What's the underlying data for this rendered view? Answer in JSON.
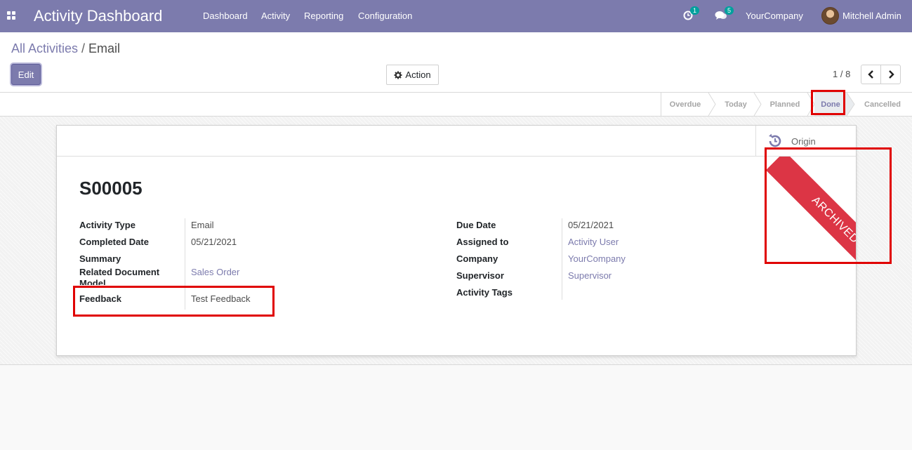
{
  "navbar": {
    "app_title": "Activity Dashboard",
    "menu": [
      "Dashboard",
      "Activity",
      "Reporting",
      "Configuration"
    ],
    "activity_count": "1",
    "message_count": "5",
    "company": "YourCompany",
    "user": "Mitchell Admin"
  },
  "breadcrumb": {
    "parent": "All Activities",
    "separator": "/",
    "current": "Email"
  },
  "buttons": {
    "edit": "Edit",
    "action": "Action"
  },
  "pager": {
    "value": "1 / 8"
  },
  "statusbar": {
    "stages": [
      "Overdue",
      "Today",
      "Planned",
      "Done",
      "Cancelled"
    ],
    "active": "Done"
  },
  "sheet": {
    "origin_label": "Origin",
    "ribbon": "ARCHIVED",
    "name": "S00005",
    "left_fields": [
      {
        "label": "Activity Type",
        "value": "Email"
      },
      {
        "label": "Completed Date",
        "value": "05/21/2021"
      },
      {
        "label": "Summary",
        "value": ""
      },
      {
        "label": "Related Document Model",
        "value": "Sales Order"
      },
      {
        "label": "Feedback",
        "value": "Test Feedback"
      }
    ],
    "right_fields": [
      {
        "label": "Due Date",
        "value": "05/21/2021"
      },
      {
        "label": "Assigned to",
        "value": "Activity User"
      },
      {
        "label": "Company",
        "value": "YourCompany"
      },
      {
        "label": "Supervisor",
        "value": "Supervisor"
      },
      {
        "label": "Activity Tags",
        "value": ""
      }
    ]
  },
  "colors": {
    "primary": "#7c7bad",
    "ribbon": "#dc3545",
    "highlight": "#e00000"
  }
}
